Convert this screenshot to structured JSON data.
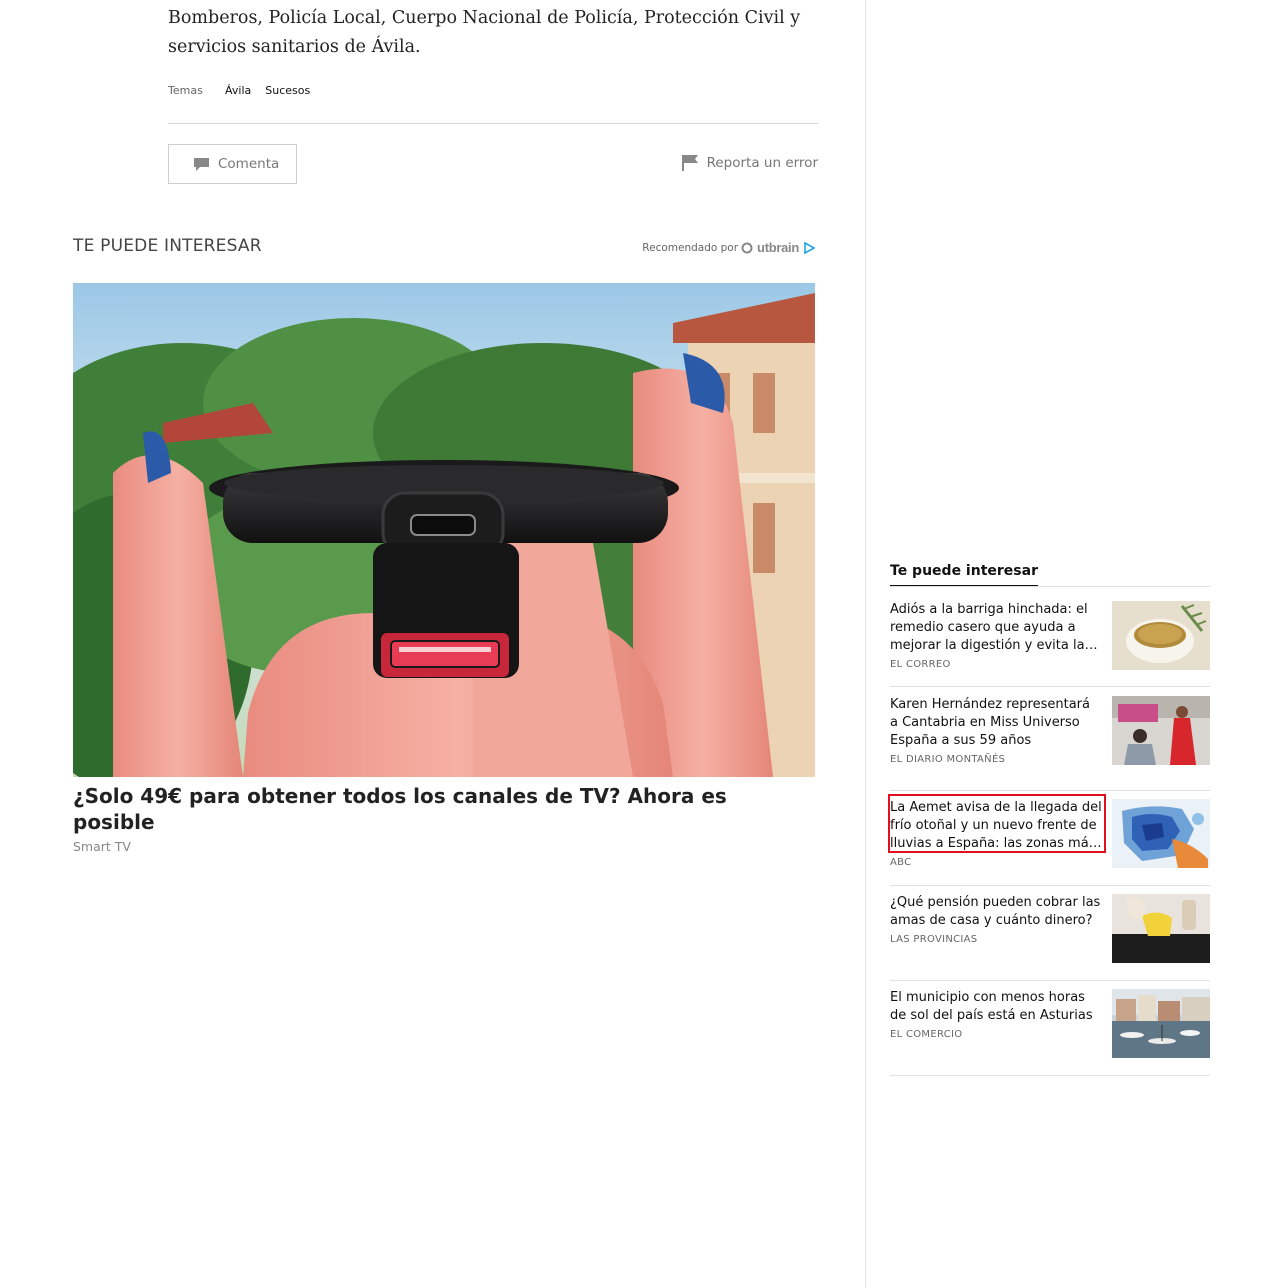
{
  "article": {
    "text": "Bomberos, Policía Local, Cuerpo Nacional de Policía, Protección Civil y servicios sanitarios de Ávila.",
    "topics_label": "Temas",
    "topics": [
      "Ávila",
      "Sucesos"
    ],
    "comment_label": "Comenta",
    "report_label": "Reporta un error"
  },
  "recommendations": {
    "title": "TE PUEDE INTERESAR",
    "recommended_by": "Recomendado por",
    "provider": "Outbrain",
    "promo": {
      "headline": "¿Solo 49€ para obtener todos los canales de TV? Ahora es posible",
      "source": "Smart TV"
    }
  },
  "sidebar": {
    "title": "Te puede interesar",
    "items": [
      {
        "headline": "Adiós a la barriga hinchada: el remedio casero que ayuda a mejorar la digestión y evita la hinchazón",
        "source": "EL CORREO",
        "thumb": "tea-cup-image"
      },
      {
        "headline": "Karen Hernández representará a Cantabria en Miss Universo España a sus 59 años",
        "source": "EL DIARIO MONTAÑÉS",
        "thumb": "woman-red-dress-image"
      },
      {
        "headline": "La Aemet avisa de la llegada del frío otoñal y un nuevo frente de lluvias a España: las zonas más afectadas",
        "source": "ABC",
        "thumb": "weather-map-image"
      },
      {
        "headline": "¿Qué pensión pueden cobrar las amas de casa y cuánto dinero?",
        "source": "LAS PROVINCIAS",
        "thumb": "cleaning-glove-image"
      },
      {
        "headline": "El municipio con menos horas de sol del país está en Asturias",
        "source": "EL COMERCIO",
        "thumb": "harbor-image"
      }
    ]
  },
  "colors": {
    "highlight": "#e0101f",
    "outbrain_accent": "#1fa6e0"
  }
}
